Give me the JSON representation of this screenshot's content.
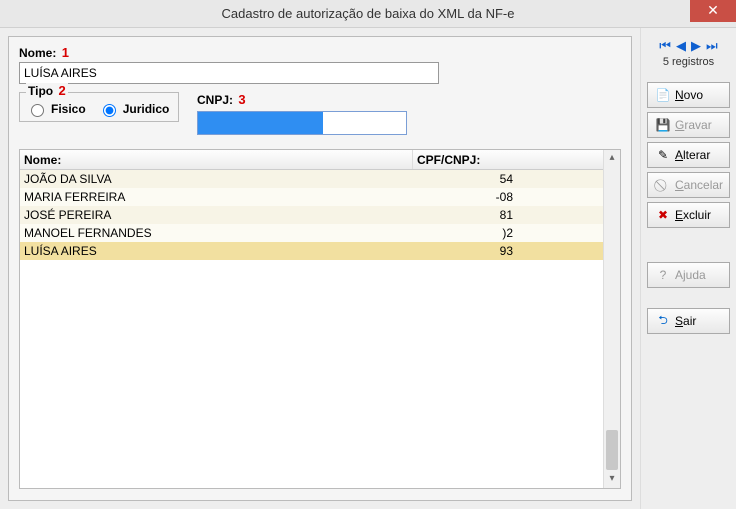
{
  "window": {
    "title": "Cadastro de autorização de baixa do XML da NF-e"
  },
  "markers": {
    "nome": "1",
    "tipo": "2",
    "cnpj": "3"
  },
  "labels": {
    "nome": "Nome:",
    "tipo": "Tipo",
    "cnpj": "CNPJ:",
    "fisico": "Fisico",
    "juridico": "Juridico"
  },
  "form": {
    "nome_value": "LUÍSA AIRES",
    "tipo_selected": "juridico",
    "cnpj_value": ""
  },
  "table": {
    "headers": {
      "nome": "Nome:",
      "cpf": "CPF/CNPJ:"
    },
    "rows": [
      {
        "nome": "JOÃO DA SILVA",
        "cpf": "54",
        "selected": false
      },
      {
        "nome": "MARIA FERREIRA",
        "cpf": "-08",
        "selected": false
      },
      {
        "nome": "JOSÉ PEREIRA",
        "cpf": "81",
        "selected": false
      },
      {
        "nome": "MANOEL FERNANDES",
        "cpf": ")2",
        "selected": false
      },
      {
        "nome": "LUÍSA AIRES",
        "cpf": "93",
        "selected": true
      }
    ]
  },
  "sidebar": {
    "record_count": "5 registros",
    "buttons": {
      "novo": "Novo",
      "gravar": "Gravar",
      "alterar": "Alterar",
      "cancelar": "Cancelar",
      "excluir": "Excluir",
      "ajuda": "Ajuda",
      "sair": "Sair"
    }
  },
  "colors": {
    "accent_blue": "#2f8ef2",
    "close_red": "#c94f45",
    "marker_red": "#d80000"
  }
}
